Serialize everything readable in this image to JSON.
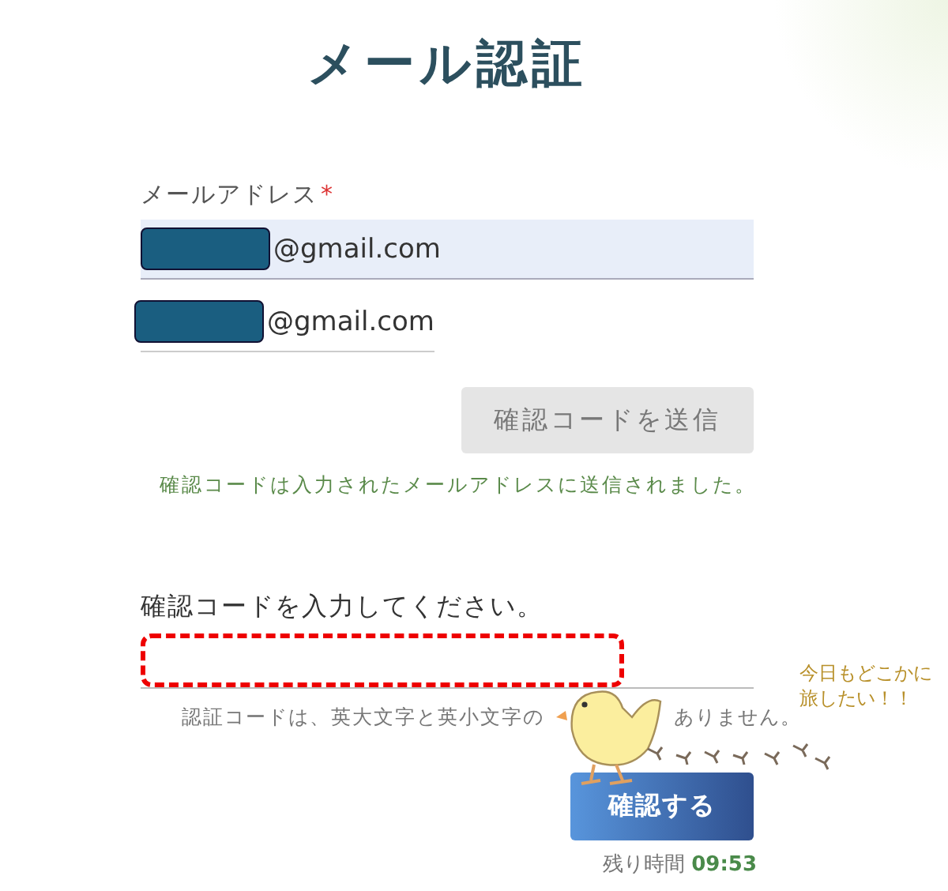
{
  "title": "メール認証",
  "email": {
    "label": "メールアドレス",
    "required_mark": "*",
    "fields": [
      {
        "value": "@gmail.com",
        "redacted": true,
        "highlighted": true
      },
      {
        "value": "@gmail.com",
        "redacted": true,
        "highlighted": false
      }
    ]
  },
  "send_button": {
    "label": "確認コードを送信",
    "disabled": true
  },
  "sent_message": "確認コードは入力されたメールアドレスに送信されました。",
  "code": {
    "label": "確認コードを入力してください。",
    "outlined": true,
    "hint_parts": [
      "認証コードは、英大文字と英小文字の",
      "ありません。"
    ]
  },
  "confirm_button": {
    "label": "確認する"
  },
  "timer": {
    "label": "残り時間",
    "value": "09:53"
  },
  "sticker": {
    "caption_lines": [
      "今日もどこかに",
      "旅したい！！"
    ]
  }
}
